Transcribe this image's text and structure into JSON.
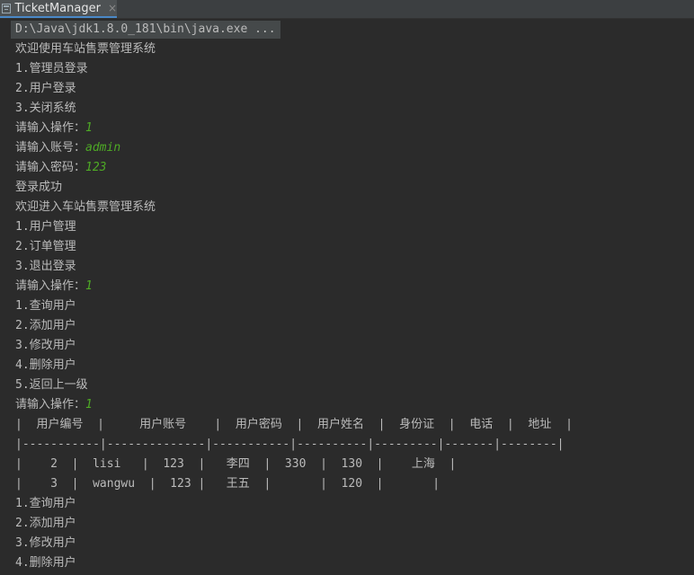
{
  "tab": {
    "title": "TicketManager",
    "close_glyph": "×",
    "icon": "console-icon"
  },
  "console": {
    "command": "D:\\Java\\jdk1.8.0_181\\bin\\java.exe ...",
    "lines": [
      {
        "text": "欢迎使用车站售票管理系统"
      },
      {
        "text": "1.管理员登录"
      },
      {
        "text": "2.用户登录"
      },
      {
        "text": "3.关闭系统"
      },
      {
        "text": "请输入操作：",
        "input": "1"
      },
      {
        "text": "请输入账号：",
        "input": "admin"
      },
      {
        "text": "请输入密码：",
        "input": "123"
      },
      {
        "text": "登录成功"
      },
      {
        "text": "欢迎进入车站售票管理系统"
      },
      {
        "text": "1.用户管理"
      },
      {
        "text": "2.订单管理"
      },
      {
        "text": "3.退出登录"
      },
      {
        "text": "请输入操作：",
        "input": "1"
      },
      {
        "text": "1.查询用户"
      },
      {
        "text": "2.添加用户"
      },
      {
        "text": "3.修改用户"
      },
      {
        "text": "4.删除用户"
      },
      {
        "text": "5.返回上一级"
      },
      {
        "text": "请输入操作：",
        "input": "1"
      },
      {
        "text": "|  用户编号  |     用户账号    |  用户密码  |  用户姓名  |  身份证  |  电话  |  地址  |"
      },
      {
        "text": "|-----------|--------------|-----------|----------|---------|-------|--------|"
      },
      {
        "text": "|    2  |  lisi   |  123  |   李四  |  330  |  130  |    上海  |"
      },
      {
        "text": "|    3  |  wangwu  |  123 |   王五  |       |  120  |       |"
      },
      {
        "text": "1.查询用户"
      },
      {
        "text": "2.添加用户"
      },
      {
        "text": "3.修改用户"
      },
      {
        "text": "4.删除用户"
      }
    ]
  }
}
